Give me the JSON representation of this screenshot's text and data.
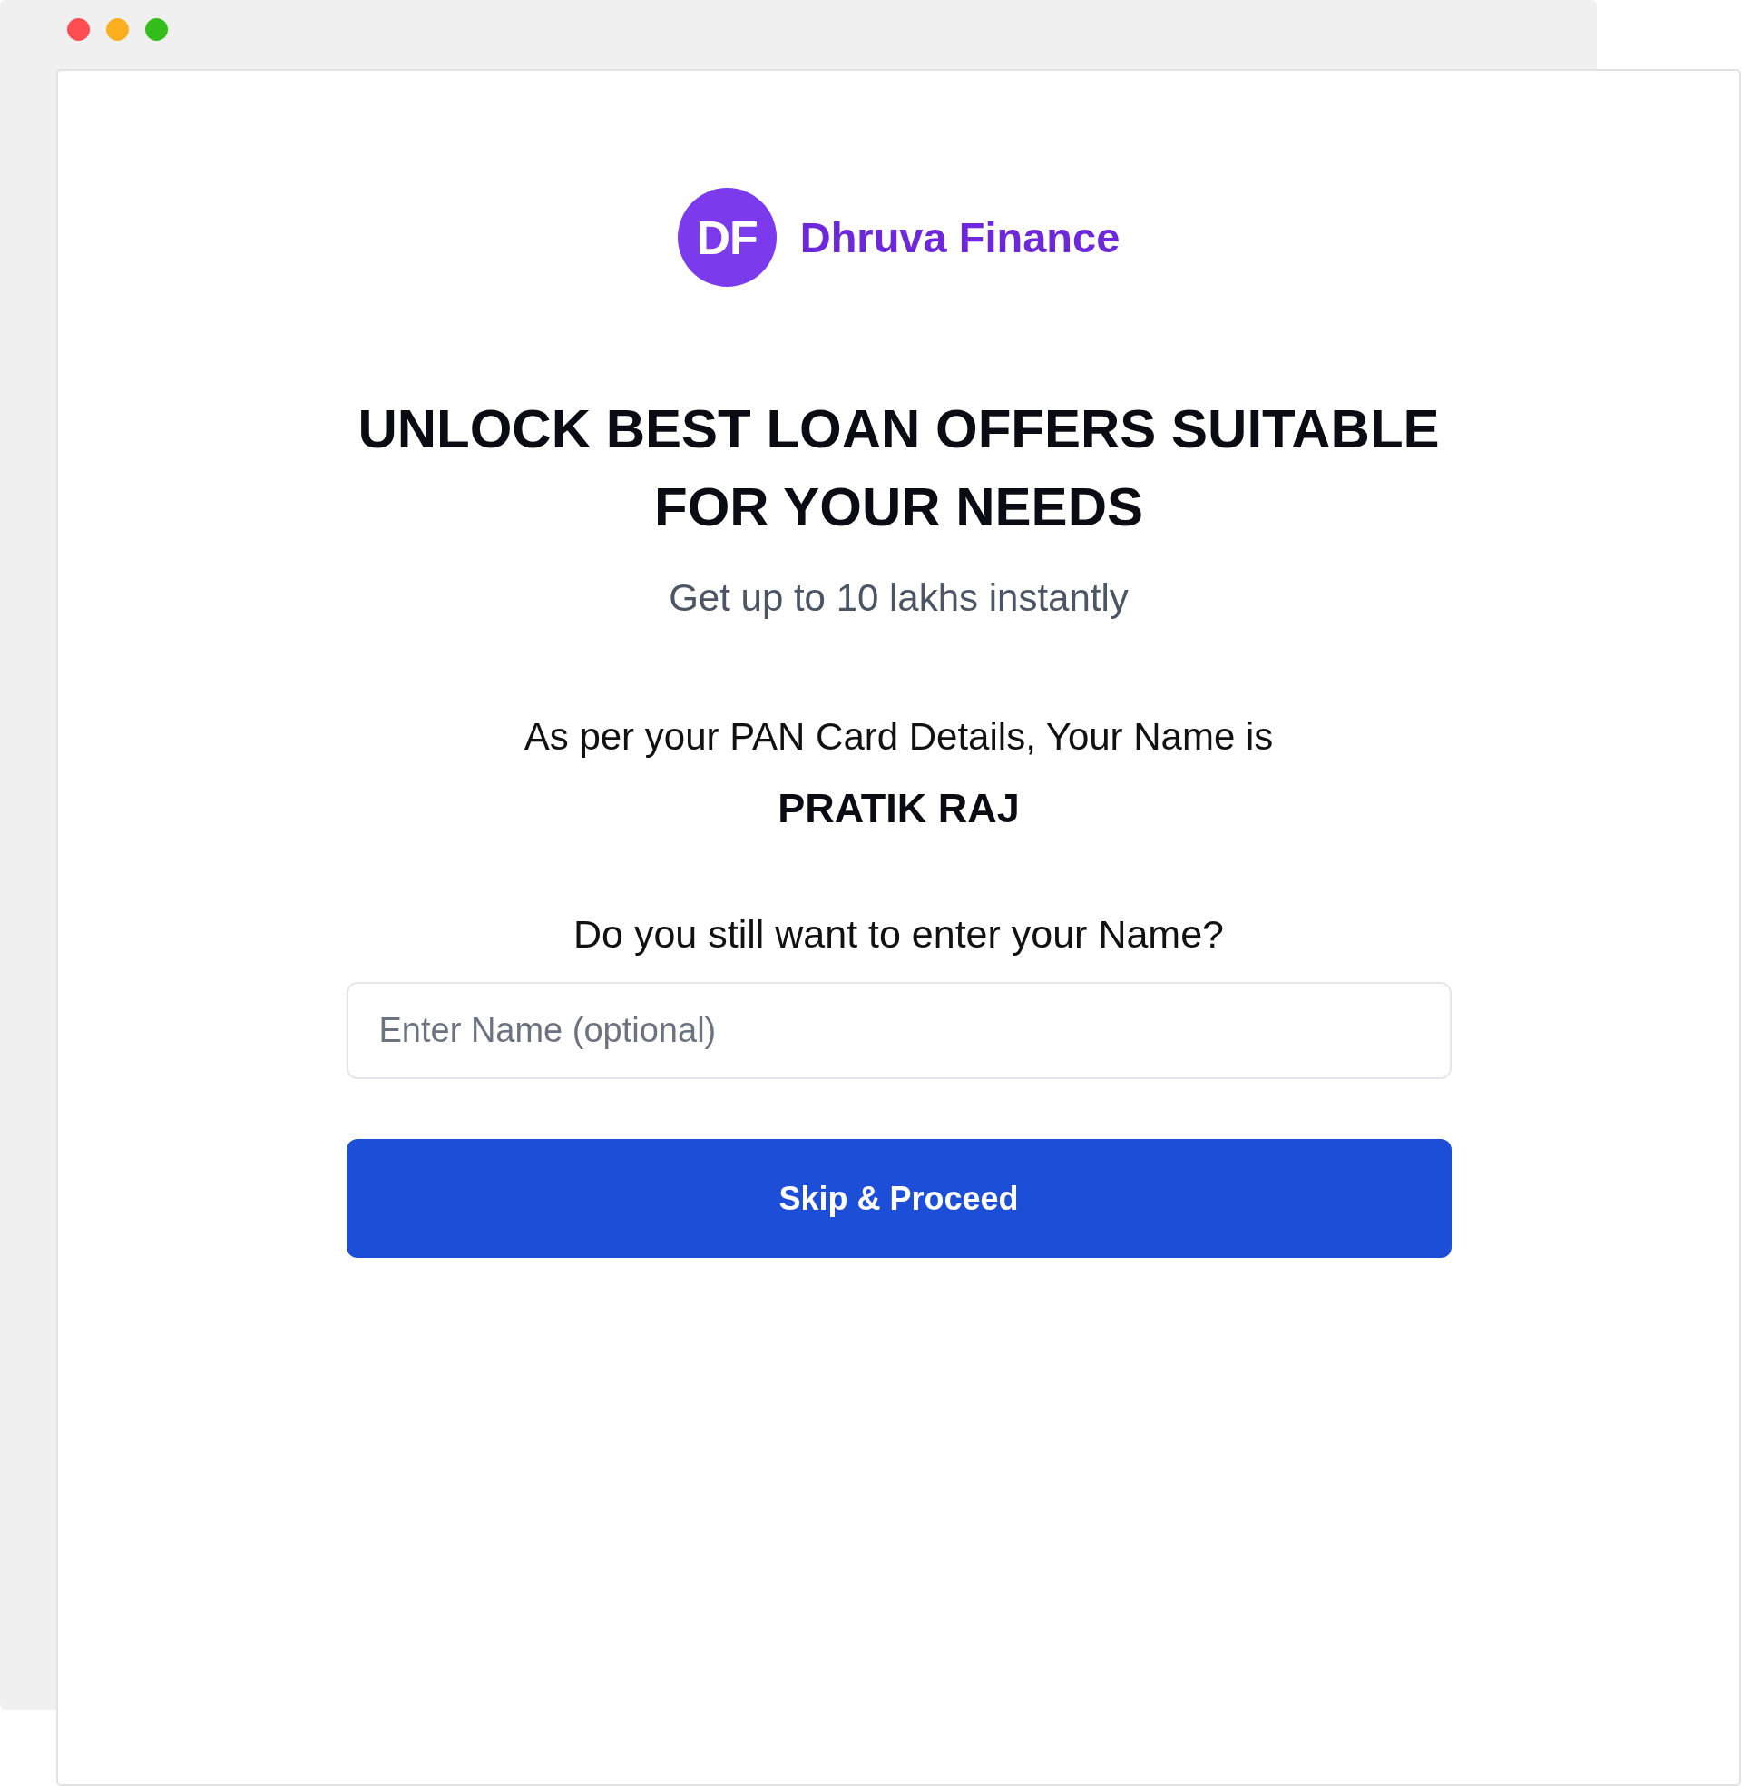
{
  "window_controls": [
    {
      "color": "#ff4d52"
    },
    {
      "color": "#feaf1f"
    },
    {
      "color": "#35bd1c"
    }
  ],
  "brand": {
    "initials": "DF",
    "name": "Dhruva Finance"
  },
  "heading": "UNLOCK BEST LOAN OFFERS SUITABLE FOR YOUR NEEDS",
  "subtitle": "Get up to 10 lakhs instantly",
  "pan_notice": {
    "text": "As per your PAN Card Details, Your Name is",
    "name": "PRATIK RAJ"
  },
  "question": "Do you still want to enter your Name?",
  "name_field": {
    "placeholder": "Enter Name (optional)"
  },
  "primary_button": {
    "label": "Skip & Proceed"
  }
}
